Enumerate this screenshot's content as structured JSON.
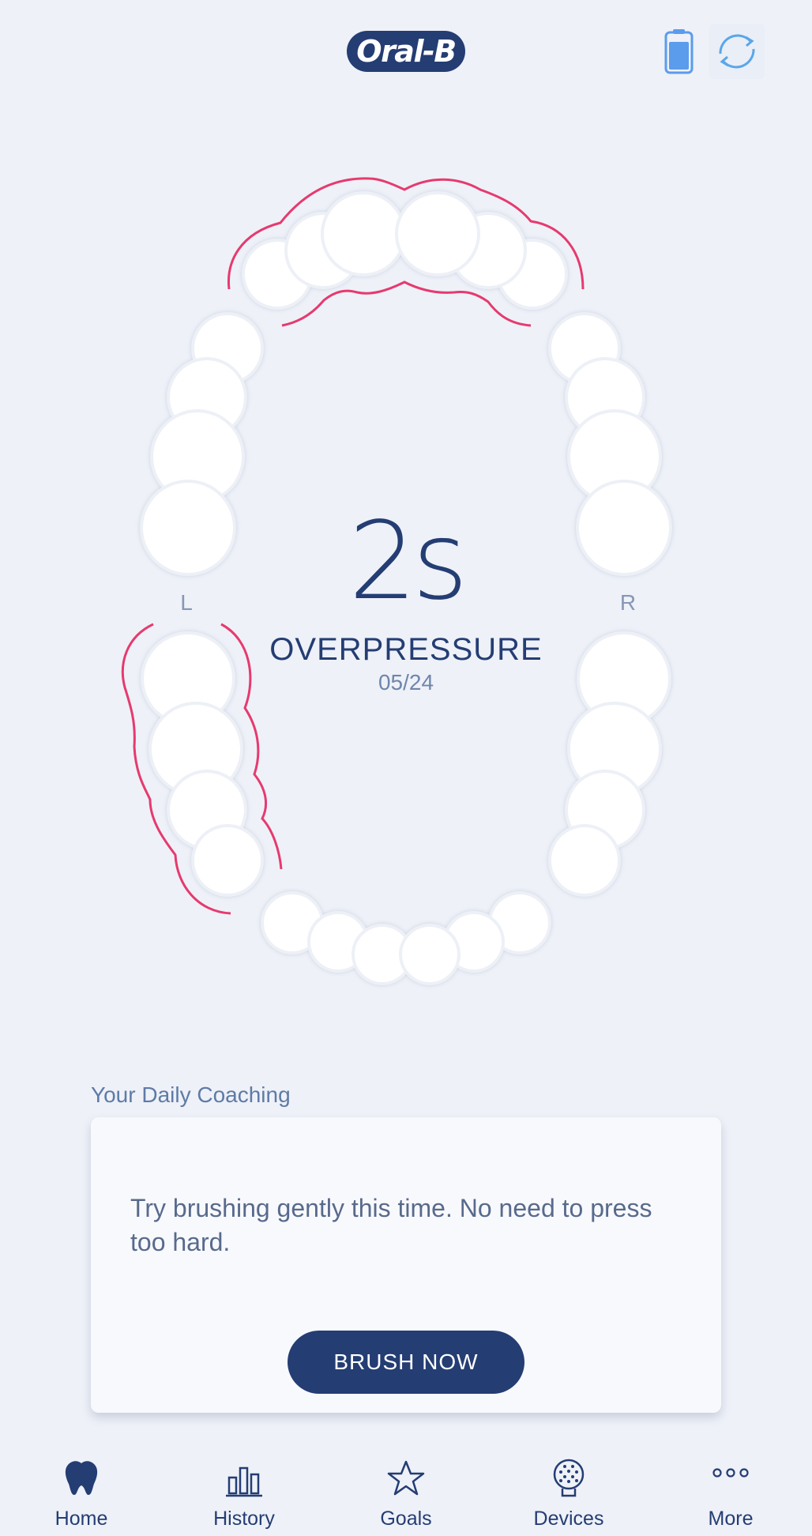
{
  "header": {
    "logo_text": "Oral-B",
    "icons": [
      "battery-icon",
      "sync-icon"
    ]
  },
  "session": {
    "left_label": "L",
    "right_label": "R",
    "value": "2s",
    "event": "OVERPRESSURE",
    "date": "05/24"
  },
  "coaching": {
    "title": "Your Daily Coaching",
    "message": "Try brushing gently this time. No need to press too hard.",
    "button_label": "BRUSH NOW"
  },
  "nav": {
    "items": [
      {
        "label": "Home",
        "icon": "tooth-icon",
        "active": true
      },
      {
        "label": "History",
        "icon": "bar-chart-icon",
        "active": false
      },
      {
        "label": "Goals",
        "icon": "star-icon",
        "active": false
      },
      {
        "label": "Devices",
        "icon": "brush-head-icon",
        "active": false
      },
      {
        "label": "More",
        "icon": "more-dots-icon",
        "active": false
      }
    ]
  },
  "colors": {
    "background": "#eef1f8",
    "brand_navy": "#243d73",
    "overpressure_highlight": "#e63a6e",
    "battery_fill": "#5b9cec"
  }
}
